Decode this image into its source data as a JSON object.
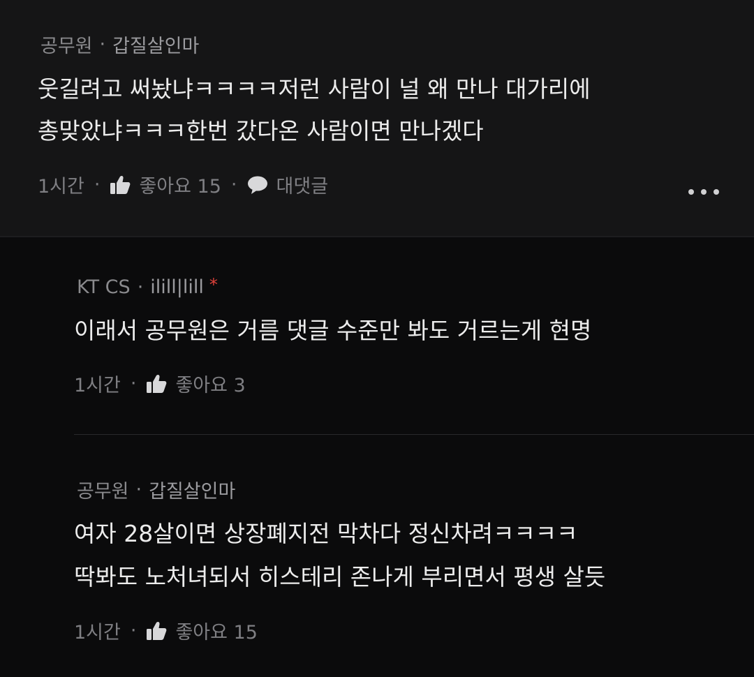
{
  "comments": [
    {
      "author": "공무원",
      "nickname": "갑질살인마",
      "lines": [
        "웃길려고 써놨냐ㅋㅋㅋㅋ저런 사람이 널 왜 만나 대가리에",
        "총맞았냐ㅋㅋㅋ한번 갔다온 사람이면 만나겠다"
      ],
      "time": "1시간",
      "like_label": "좋아요 15",
      "reply_label": "대댓글"
    }
  ],
  "replies": [
    {
      "author": "KT CS",
      "nickname": "ilill|lill",
      "star": "*",
      "lines": [
        "이래서 공무원은 거름 댓글 수준만 봐도 거르는게 현명"
      ],
      "time": "1시간",
      "like_label": "좋아요 3"
    },
    {
      "author": "공무원",
      "nickname": "갑질살인마",
      "lines": [
        "여자 28살이면 상장폐지전 막차다 정신차려ㅋㅋㅋㅋ",
        "딱봐도 노처녀되서 히스테리 존나게 부리면서 평생 살듯"
      ],
      "time": "1시간",
      "like_label": "좋아요 15"
    }
  ],
  "separator": "·",
  "icons": {
    "like": "thumbs-up-icon",
    "reply": "speech-bubble-icon",
    "more": "more-horizontal-icon"
  },
  "colors": {
    "background": "#0b0b0c",
    "main_comment_bg": "#151516",
    "text": "#ececec",
    "meta": "#8a8a8d",
    "star": "#e0423b"
  }
}
